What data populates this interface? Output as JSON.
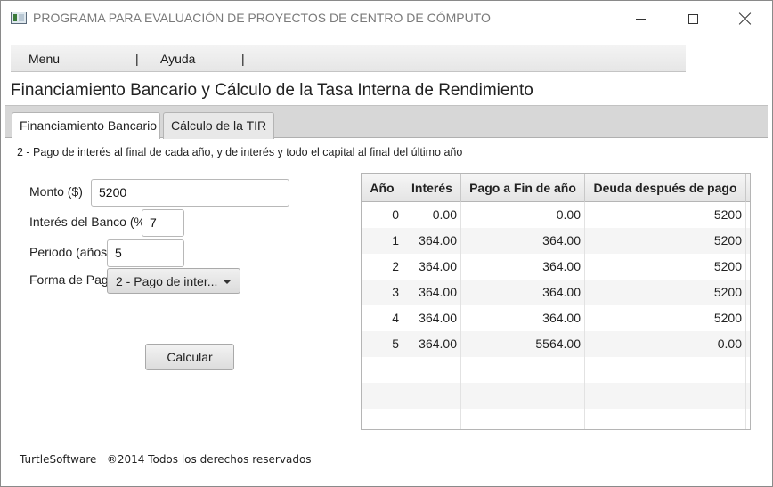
{
  "window": {
    "title": "PROGRAMA PARA EVALUACIÓN DE PROYECTOS DE CENTRO DE CÓMPUTO",
    "icon": "app-window-icon",
    "controls": [
      "minimize-icon",
      "maximize-icon",
      "close-icon"
    ]
  },
  "menubar": {
    "items": [
      "Menu",
      "Ayuda"
    ],
    "separator": "|"
  },
  "page_title": "Financiamiento Bancario y Cálculo de la Tasa Interna de Rendimiento",
  "tabs": [
    {
      "label": "Financiamiento Bancario",
      "selected": true
    },
    {
      "label": "Cálculo de la TIR",
      "selected": false
    }
  ],
  "description": "2 - Pago de interés al final de cada año,  y de interés y todo el capital al final del último año",
  "form": {
    "monto_label": "Monto ($)",
    "monto_value": "5200",
    "interes_label": "Interés del Banco (%",
    "interes_value": "7",
    "periodo_label": "Periodo (años",
    "periodo_value": "5",
    "forma_label": "Forma de Pago",
    "forma_value": "2 - Pago de inter...",
    "calcular_label": "Calcular"
  },
  "table": {
    "headers": [
      "Año",
      "Interés",
      "Pago a Fin de año",
      "Deuda después de pago"
    ],
    "rows": [
      [
        "0",
        "0.00",
        "0.00",
        "5200"
      ],
      [
        "1",
        "364.00",
        "364.00",
        "5200"
      ],
      [
        "2",
        "364.00",
        "364.00",
        "5200"
      ],
      [
        "3",
        "364.00",
        "364.00",
        "5200"
      ],
      [
        "4",
        "364.00",
        "364.00",
        "5200"
      ],
      [
        "5",
        "364.00",
        "5564.00",
        "0.00"
      ],
      [
        "",
        "",
        "",
        ""
      ],
      [
        "",
        "",
        "",
        ""
      ],
      [
        "",
        "",
        "",
        ""
      ]
    ]
  },
  "footer": {
    "company": "TurtleSoftware",
    "rights": "®2014 Todos los derechos reservados"
  }
}
